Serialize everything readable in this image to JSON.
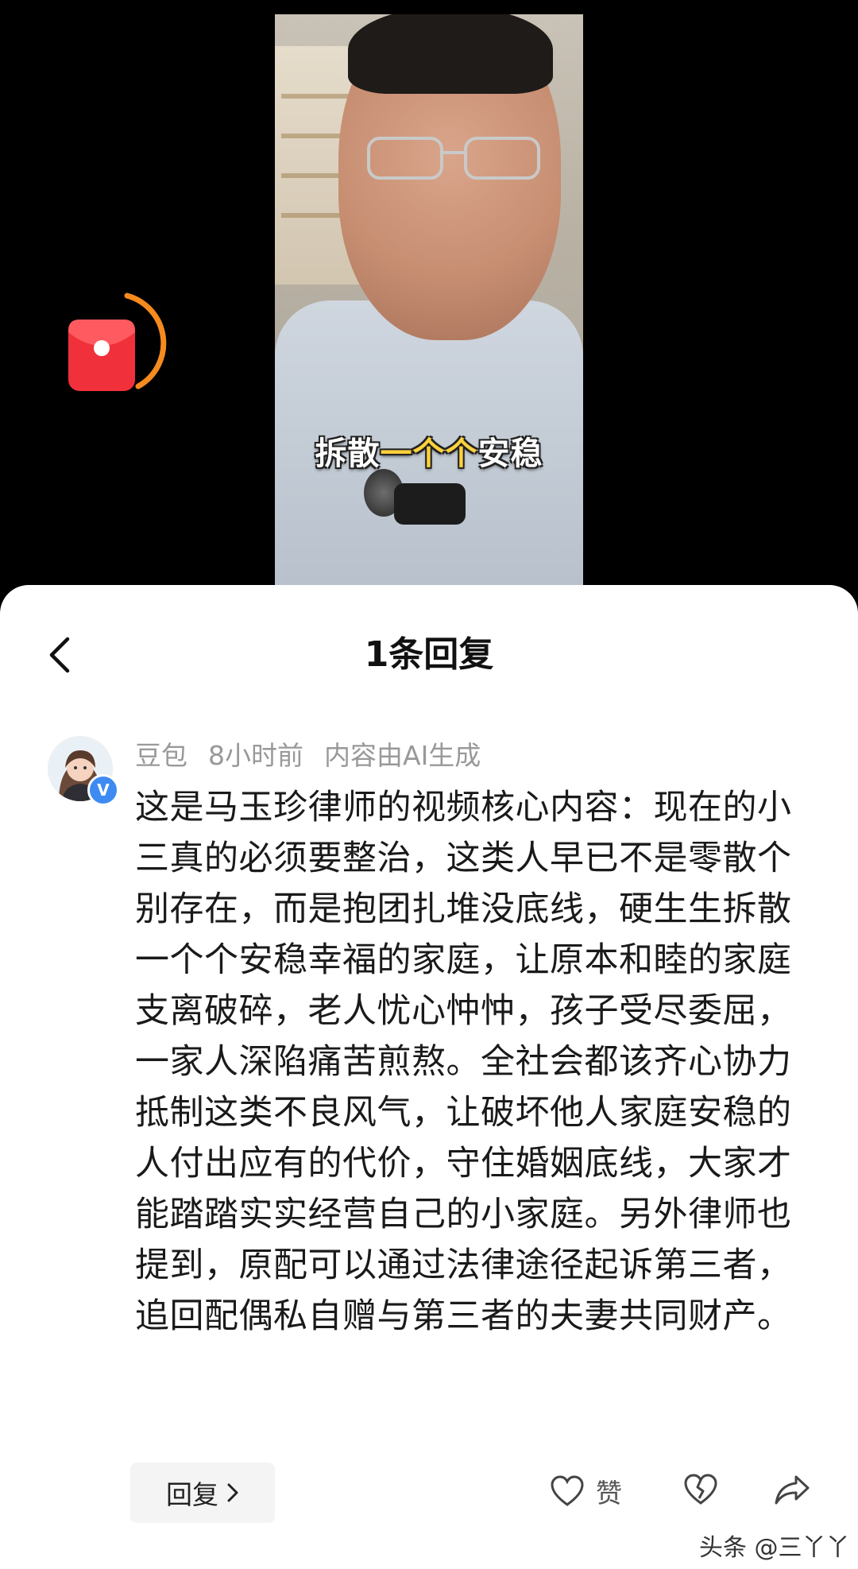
{
  "video": {
    "caption_prefix": "拆散",
    "caption_highlight": "一个个",
    "caption_suffix": "安稳"
  },
  "sheet": {
    "title": "1条回复"
  },
  "comment": {
    "author": "豆包",
    "time": "8小时前",
    "ai_note": "内容由AI生成",
    "text": "这是马玉珍律师的视频核心内容：现在的小三真的必须要整治，这类人早已不是零散个别存在，而是抱团扎堆没底线，硬生生拆散一个个安稳幸福的家庭，让原本和睦的家庭支离破碎，老人忧心忡忡，孩子受尽委屈，一家人深陷痛苦煎熬。全社会都该齐心协力抵制这类不良风气，让破坏他人家庭安稳的人付出应有的代价，守住婚姻底线，大家才能踏踏实实经营自己的小家庭。另外律师也提到，原配可以通过法律途径起诉第三者，追回配偶私自赠与第三者的夫妻共同财产。",
    "verified_mark": "V"
  },
  "actions": {
    "reply_label": "回复",
    "like_label": "赞"
  },
  "watermark": "头条 @三丫丫",
  "colors": {
    "caption_highlight": "#ffd23c",
    "redpacket": "#f0303a",
    "ring": "#f58a1f",
    "verified": "#3d8bf2",
    "meta": "#999999"
  },
  "icons": {
    "back": "chevron-left-icon",
    "like": "heart-outline-icon",
    "dislike": "broken-heart-icon",
    "share": "share-arrow-icon",
    "redpacket": "red-envelope-icon"
  }
}
